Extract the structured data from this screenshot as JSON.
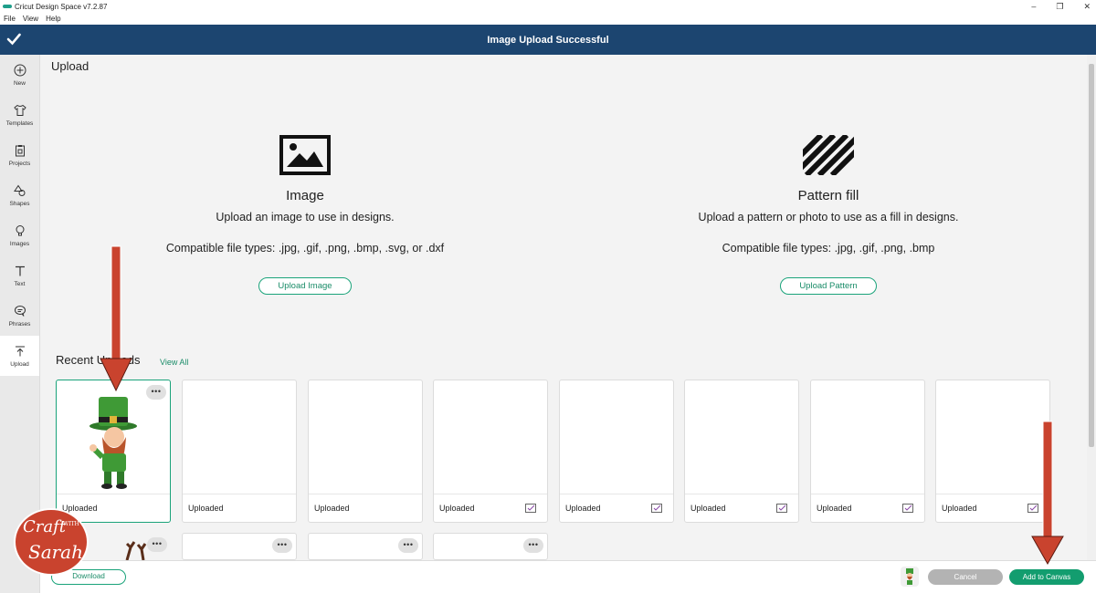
{
  "window": {
    "title": "Cricut Design Space  v7.2.87",
    "controls": [
      "–",
      "❐",
      "✕"
    ]
  },
  "menu": [
    "File",
    "View",
    "Help"
  ],
  "banner": {
    "title": "Image Upload Successful"
  },
  "sidebar": {
    "items": [
      {
        "label": "New",
        "icon": "plus-circle-icon"
      },
      {
        "label": "Templates",
        "icon": "shirt-icon"
      },
      {
        "label": "Projects",
        "icon": "clipboard-icon"
      },
      {
        "label": "Shapes",
        "icon": "shapes-icon"
      },
      {
        "label": "Images",
        "icon": "lightbulb-icon"
      },
      {
        "label": "Text",
        "icon": "text-icon"
      },
      {
        "label": "Phrases",
        "icon": "speech-bubble-icon"
      },
      {
        "label": "Upload",
        "icon": "upload-icon",
        "active": true
      }
    ]
  },
  "main": {
    "title": "Upload",
    "image_card": {
      "title": "Image",
      "description": "Upload an image to use in designs.",
      "file_types": "Compatible file types: .jpg, .gif, .png, .bmp, .svg, or .dxf",
      "button": "Upload Image"
    },
    "pattern_card": {
      "title": "Pattern fill",
      "description": "Upload a pattern or photo to use as a fill in designs.",
      "file_types": "Compatible file types: .jpg, .gif, .png, .bmp",
      "button": "Upload Pattern"
    },
    "recent": {
      "heading": "Recent Uploads",
      "view_all": "View All",
      "tiles": [
        {
          "label": "Uploaded",
          "selected": true,
          "has_image": true
        },
        {
          "label": "Uploaded"
        },
        {
          "label": "Uploaded"
        },
        {
          "label": "Uploaded",
          "checked": true
        },
        {
          "label": "Uploaded",
          "checked": true
        },
        {
          "label": "Uploaded",
          "checked": true
        },
        {
          "label": "Uploaded",
          "checked": true
        },
        {
          "label": "Uploaded",
          "checked": true
        }
      ],
      "menu_glyph": "•••"
    }
  },
  "bottom": {
    "download": "Download",
    "cancel": "Cancel",
    "add_to_canvas": "Add to Canvas"
  },
  "watermark": {
    "line1": "Craft",
    "with": "WITH",
    "line2": "Sarah"
  },
  "colors": {
    "banner": "#1c4570",
    "accent": "#139d6f",
    "annotation_arrow": "#c9432e"
  }
}
